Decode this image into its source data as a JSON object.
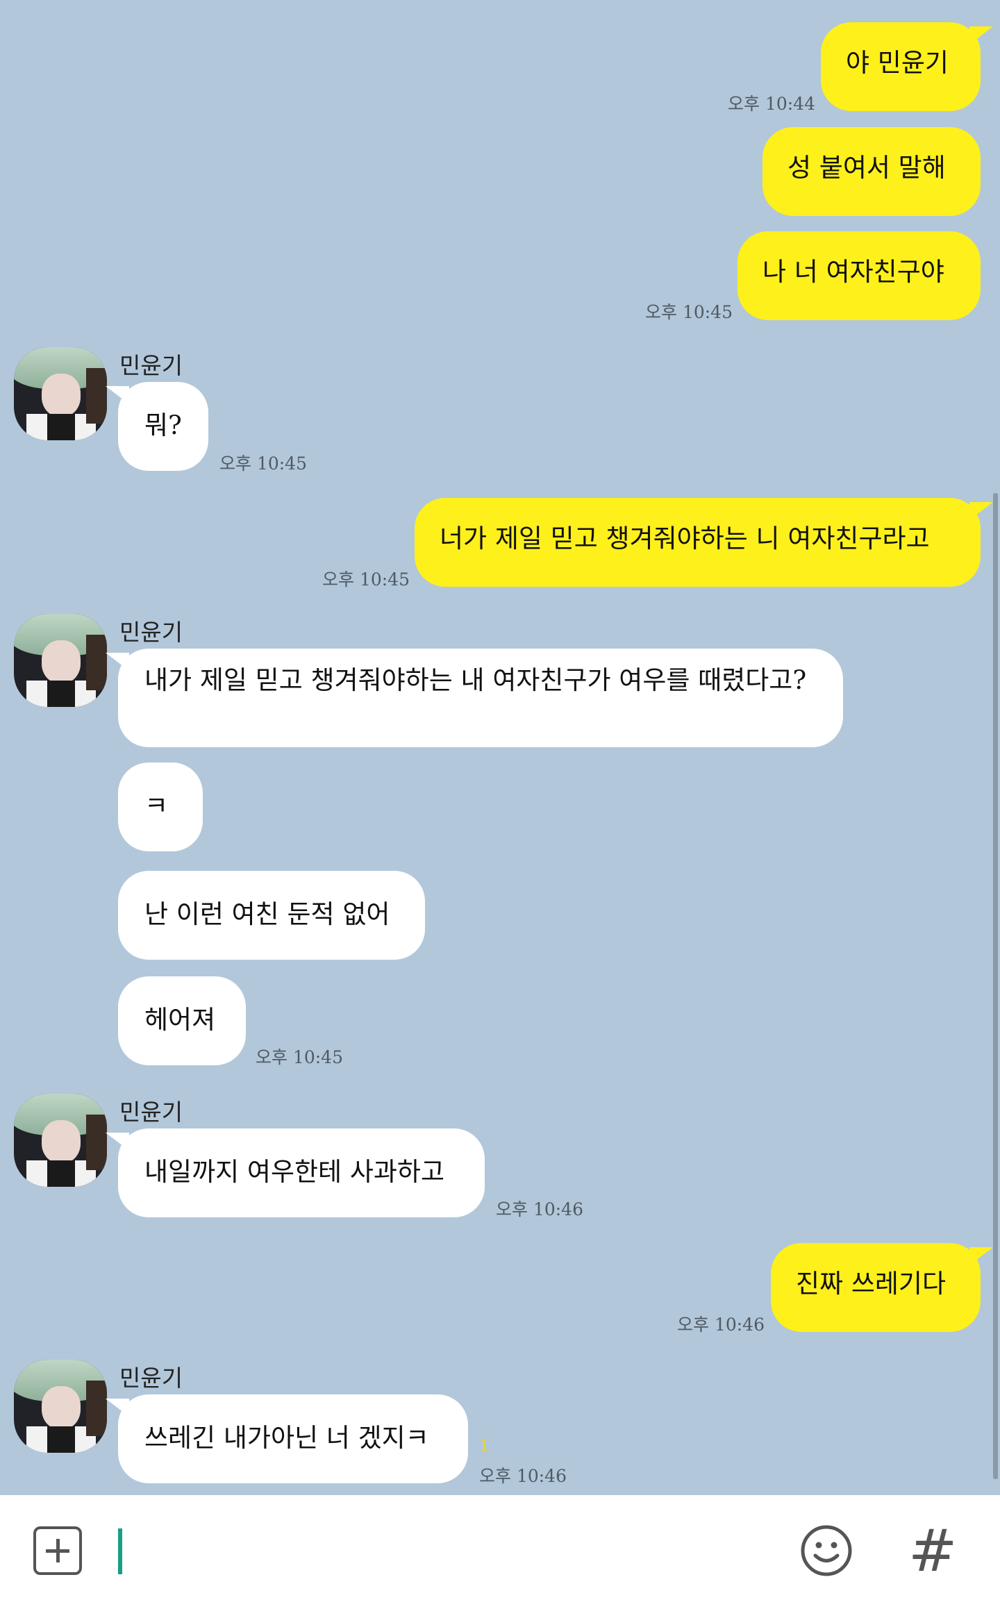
{
  "chat": {
    "contact_name": "민윤기",
    "messages": [
      {
        "text": "야 민윤기"
      },
      {
        "time": "오후 10:44"
      },
      {
        "text": "성 붙여서 말해"
      },
      {
        "text": "나 너 여자친구야"
      },
      {
        "time": "오후 10:45"
      },
      {
        "text": "뭐?"
      },
      {
        "time": "오후 10:45"
      },
      {
        "text": "너가 제일 믿고 챙겨줘야하는 니 여자친구라고"
      },
      {
        "time": "오후 10:45"
      },
      {
        "text": "내가 제일 믿고 챙겨줘야하는 내 여자친구가 여우를 때렸다고?"
      },
      {
        "text": "ㅋ"
      },
      {
        "text": "난 이런 여친 둔적 없어"
      },
      {
        "text": "헤어져"
      },
      {
        "time": "오후 10:45"
      },
      {
        "text": "내일까지 여우한테 사과하고"
      },
      {
        "time": "오후 10:46"
      },
      {
        "text": "진짜 쓰레기다"
      },
      {
        "time": "오후 10:46"
      },
      {
        "text": "쓰레긴 내가아닌 너 겠지ㅋ"
      },
      {
        "unread": "1"
      },
      {
        "time": "오후 10:46"
      }
    ]
  },
  "composer": {
    "plus_icon": "plus-icon",
    "emoji_icon": "smile-emoji-icon",
    "hash_label": "#",
    "input_value": ""
  },
  "colors": {
    "background": "#b2c7da",
    "outgoing_bubble": "#fef01b",
    "incoming_bubble": "#ffffff",
    "cursor": "#17a085"
  }
}
